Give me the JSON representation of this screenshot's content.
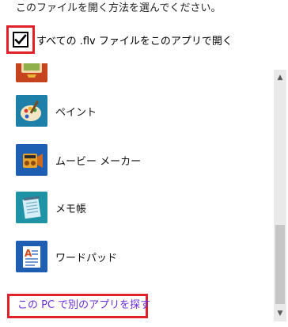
{
  "prompt": "このファイルを開く方法を選んでください。",
  "checkbox": {
    "label": "すべての .flv ファイルをこのアプリで開く",
    "checked": true
  },
  "apps": [
    {
      "name": "",
      "icon": "media-icon",
      "partially_visible": true
    },
    {
      "name": "ペイント",
      "icon": "paint-palette-icon"
    },
    {
      "name": "ムービー メーカー",
      "icon": "movie-maker-icon"
    },
    {
      "name": "メモ帳",
      "icon": "notepad-icon"
    },
    {
      "name": "ワードパッド",
      "icon": "wordpad-icon"
    }
  ],
  "find_link": "この PC で別のアプリを探す",
  "colors": {
    "highlight": "#e0202a",
    "link": "#6b2fd6",
    "icon_tile": "#1e5fb4"
  }
}
